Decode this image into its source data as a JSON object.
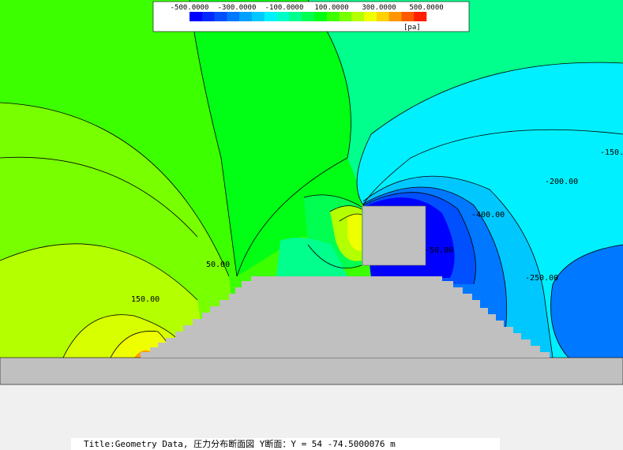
{
  "chart_data": {
    "type": "heatmap",
    "title": "Title:Geometry Data, 圧力分布断面図 Y断面：Y = 54   -74.5000076 m",
    "colorbar": {
      "range": [
        -500,
        500
      ],
      "tick_labels": [
        "-500.0000",
        "-300.0000",
        "-100.0000",
        "100.0000",
        "300.0000",
        "500.0000"
      ],
      "unit": "[pa]",
      "colors": [
        "#0000ff",
        "#0028ff",
        "#0050ff",
        "#0078ff",
        "#00a0ff",
        "#00c8ff",
        "#00f0ff",
        "#00ffc8",
        "#00ff8c",
        "#00ff50",
        "#00ff14",
        "#3cff00",
        "#78ff00",
        "#b4ff00",
        "#f0ff00",
        "#ffd200",
        "#ff9600",
        "#ff5a00",
        "#ff1e00"
      ]
    },
    "contour_labels": [
      "-150.",
      "-200.00",
      "-400.00",
      "-250.00",
      "-50.00",
      "50.00",
      "150.00"
    ],
    "fields": [
      {
        "level": 0,
        "color": "#3cff00"
      },
      {
        "level": 50,
        "color": "#78ff00"
      },
      {
        "level": 100,
        "color": "#b4ff00"
      },
      {
        "level": 150,
        "color": "#f0ff00"
      },
      {
        "level": 200,
        "color": "#ffd200"
      },
      {
        "level": -50,
        "color": "#00ff14"
      },
      {
        "level": -100,
        "color": "#00ff8c"
      },
      {
        "level": -150,
        "color": "#00f0ff"
      },
      {
        "level": -250,
        "color": "#00c8ff"
      },
      {
        "level": -300,
        "color": "#0078ff"
      },
      {
        "level": -400,
        "color": "#0050ff"
      },
      {
        "level": -500,
        "color": "#0000ff"
      }
    ]
  },
  "status_text": "Title:Geometry Data, 圧力分布断面図 Y断面：Y = 54   -74.5000076 m",
  "colors": {
    "solid": "#c0c0c0",
    "background": "#f0f0f0",
    "contour_line": "#000000"
  }
}
